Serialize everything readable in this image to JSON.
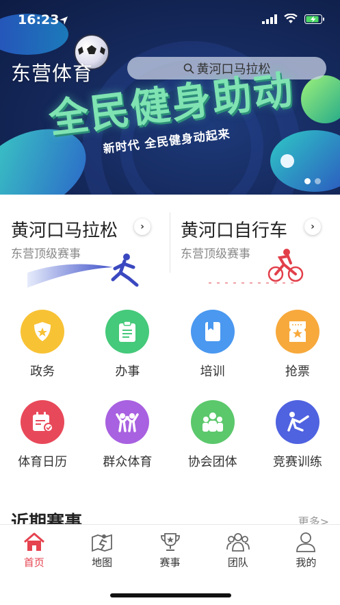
{
  "status": {
    "time": "16:23"
  },
  "header": {
    "app_name": "东营体育",
    "search_value": "黄河口马拉松",
    "banner_title": "全民健身助动",
    "banner_subtitle": "新时代 全民健身动起来"
  },
  "promos": [
    {
      "title": "黄河口马拉松",
      "subtitle": "东营顶级赛事"
    },
    {
      "title": "黄河口自行车",
      "subtitle": "东营顶级赛事"
    }
  ],
  "services_row1": [
    {
      "label": "政务",
      "icon": "shield-star-icon",
      "color": "#f8c235"
    },
    {
      "label": "办事",
      "icon": "clipboard-icon",
      "color": "#45c97a"
    },
    {
      "label": "培训",
      "icon": "book-icon",
      "color": "#4a98f0"
    },
    {
      "label": "抢票",
      "icon": "ticket-icon",
      "color": "#f7a93c"
    }
  ],
  "services_row2": [
    {
      "label": "体育日历",
      "icon": "calendar-icon",
      "color": "#e8495a"
    },
    {
      "label": "群众体育",
      "icon": "people-cheer-icon",
      "color": "#a861e0"
    },
    {
      "label": "协会团体",
      "icon": "group-icon",
      "color": "#5bc86b"
    },
    {
      "label": "竞赛训练",
      "icon": "athlete-icon",
      "color": "#4f62e0"
    }
  ],
  "recent": {
    "title": "近期赛事",
    "more": "更多>"
  },
  "tabbar": [
    {
      "label": "首页",
      "icon": "home-icon",
      "active": true
    },
    {
      "label": "地图",
      "icon": "map-icon",
      "active": false
    },
    {
      "label": "赛事",
      "icon": "trophy-icon",
      "active": false
    },
    {
      "label": "团队",
      "icon": "team-icon",
      "active": false
    },
    {
      "label": "我的",
      "icon": "profile-icon",
      "active": false
    }
  ],
  "colors": {
    "accent": "#e5434f",
    "banner_bg": "#162a5e"
  }
}
